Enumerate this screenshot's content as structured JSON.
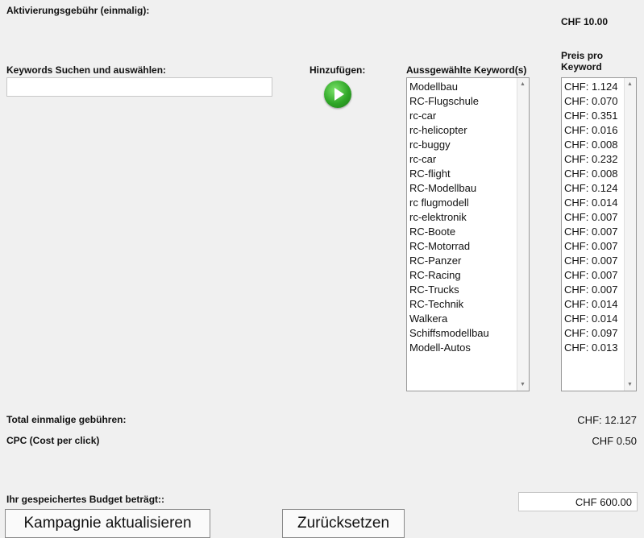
{
  "activation": {
    "label": "Aktivierungsgebühr (einmalig):",
    "value": "CHF 10.00"
  },
  "search": {
    "label": "Keywords Suchen und auswählen:",
    "value": ""
  },
  "add": {
    "label": "Hinzufügen:",
    "icon": "play-arrow-icon",
    "color": "#2fa627"
  },
  "selected": {
    "header": "Aussgewählte Keyword(s)",
    "items": [
      "Modellbau",
      "RC-Flugschule",
      "rc-car",
      "rc-helicopter",
      "rc-buggy",
      "rc-car",
      "RC-flight",
      "RC-Modellbau",
      "rc flugmodell",
      "rc-elektronik",
      "RC-Boote",
      "RC-Motorrad",
      "RC-Panzer",
      "RC-Racing",
      "RC-Trucks",
      "RC-Technik",
      "Walkera",
      "Schiffsmodellbau",
      "Modell-Autos"
    ]
  },
  "prices": {
    "header_line1": "Preis pro",
    "header_line2": "Keyword",
    "items": [
      "CHF: 1.124",
      "CHF: 0.070",
      "CHF: 0.351",
      "CHF: 0.016",
      "CHF: 0.008",
      "CHF: 0.232",
      "CHF: 0.008",
      "CHF: 0.124",
      "CHF: 0.014",
      "CHF: 0.007",
      "CHF: 0.007",
      "CHF: 0.007",
      "CHF: 0.007",
      "CHF: 0.007",
      "CHF: 0.007",
      "CHF: 0.014",
      "CHF: 0.014",
      "CHF: 0.097",
      "CHF: 0.013"
    ]
  },
  "total": {
    "label": "Total einmalige gebühren:",
    "value": "CHF: 12.127"
  },
  "cpc": {
    "label": "CPC (Cost per click)",
    "value": "CHF 0.50"
  },
  "budget": {
    "label": "Ihr gespeichertes Budget beträgt::",
    "value": "CHF 600.00"
  },
  "buttons": {
    "update": "Kampagnie aktualisieren",
    "reset": "Zurücksetzen"
  }
}
